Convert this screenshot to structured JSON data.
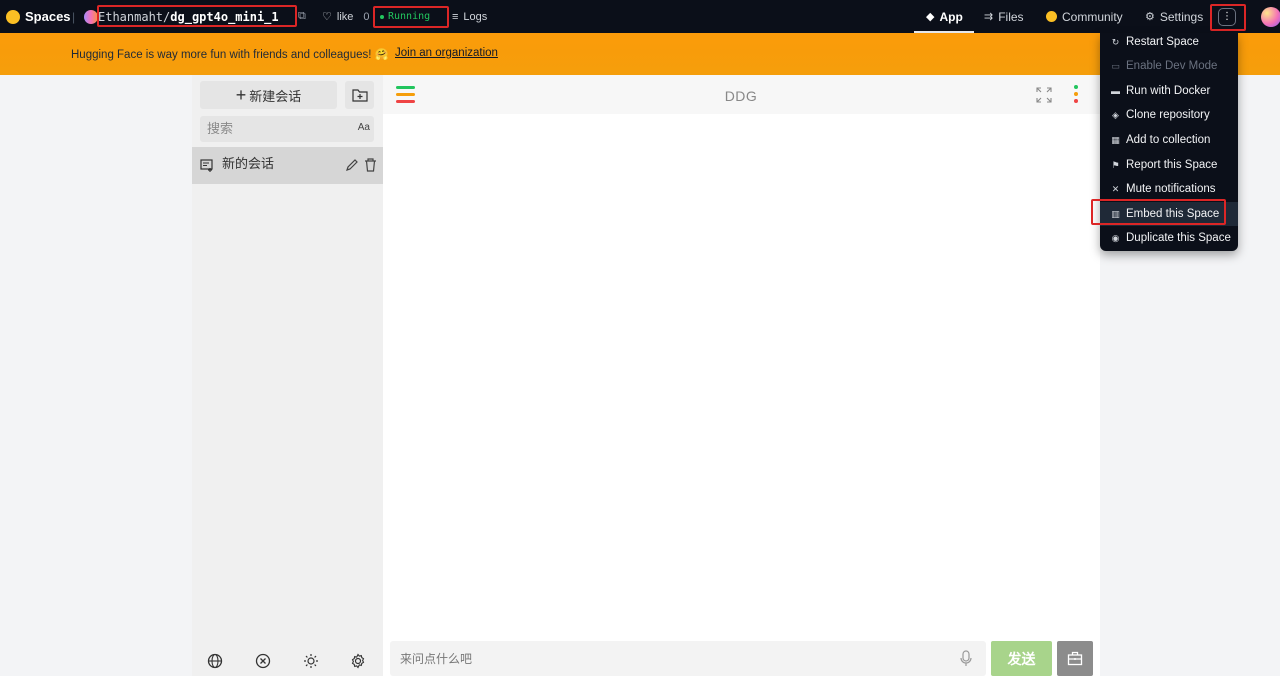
{
  "topbar": {
    "brand": "Spaces",
    "owner": "Ethanmaht",
    "slash": "/",
    "repo_name": "dg_gpt4o_mini_1",
    "like_label": "like",
    "like_count": "0",
    "status": "Running",
    "logs_label": "Logs",
    "nav": {
      "app": "App",
      "files": "Files",
      "community": "Community",
      "settings": "Settings"
    },
    "more_symbol": "⋮"
  },
  "banner": {
    "message": "Hugging Face is way more fun with friends and colleagues! 🤗",
    "link": "Join an organization"
  },
  "sidebar": {
    "new_chat": "新建会话",
    "search_placeholder": "搜索",
    "case_toggle": "Aa",
    "conversations": [
      {
        "title": "新的会话"
      }
    ]
  },
  "chat": {
    "title": "DDG",
    "input_placeholder": "来问点什么吧",
    "send_label": "发送"
  },
  "menu": {
    "items": [
      {
        "label": "Restart Space",
        "icon": "restart-icon",
        "enabled": true
      },
      {
        "label": "Enable Dev Mode",
        "icon": "terminal-icon",
        "enabled": false
      },
      {
        "label": "Run with Docker",
        "icon": "docker-icon",
        "enabled": true
      },
      {
        "label": "Clone repository",
        "icon": "git-icon",
        "enabled": true
      },
      {
        "label": "Add to collection",
        "icon": "collection-icon",
        "enabled": true
      },
      {
        "label": "Report this Space",
        "icon": "flag-icon",
        "enabled": true
      },
      {
        "label": "Mute notifications",
        "icon": "mute-icon",
        "enabled": true
      },
      {
        "label": "Embed this Space",
        "icon": "embed-icon",
        "enabled": true
      },
      {
        "label": "Duplicate this Space",
        "icon": "duplicate-icon",
        "enabled": true
      }
    ]
  },
  "colors": {
    "topbar_bg": "#0b0f19",
    "banner": "#f59e0b",
    "running": "#22c55e",
    "send_button": "#a8d48b",
    "highlight_box": "#dc2626"
  }
}
